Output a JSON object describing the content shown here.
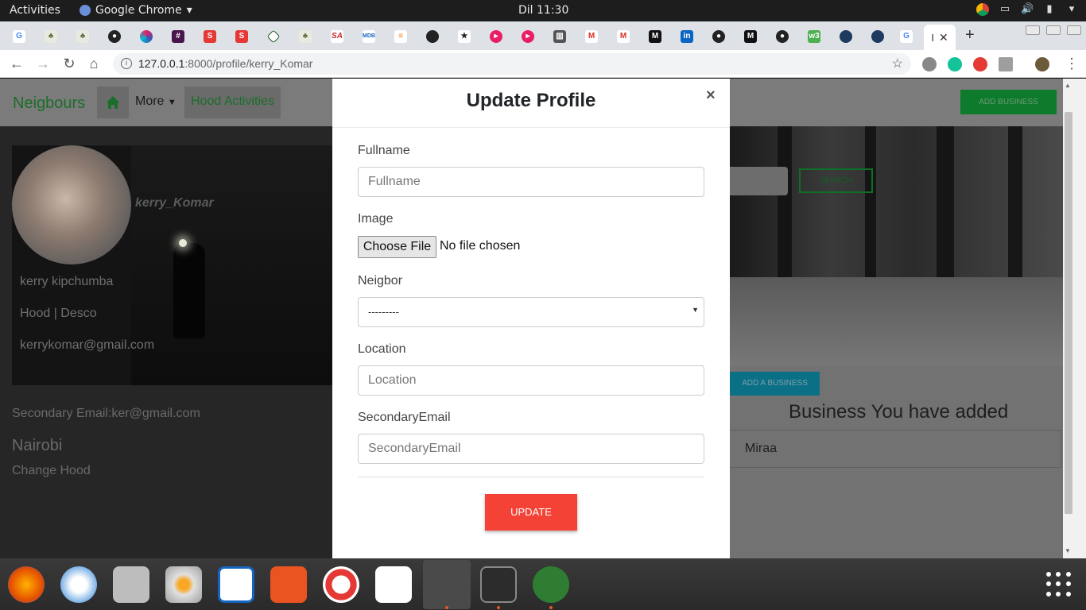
{
  "topbar": {
    "activities": "Activities",
    "app_name": "Google Chrome",
    "clock": "Dil 11:30"
  },
  "browser": {
    "url_host": "127.0.0.1",
    "url_path": ":8000/profile/kerry_Komar",
    "active_tab_label": "I",
    "new_tab": "+"
  },
  "site": {
    "brand": "Neigbours",
    "more": "More",
    "hood_activities": "Hood Activities",
    "add_business": "ADD BUSINESS"
  },
  "profile": {
    "username": "kerry_Komar",
    "fullname": "kerry kipchumba",
    "hood": "Hood | Desco",
    "email": "kerrykomar@gmail.com",
    "secondary_email": "Secondary Email:ker@gmail.com",
    "city": "Nairobi",
    "change_hood": "Change Hood"
  },
  "right_panel": {
    "search": "SEARCH",
    "add_a_business": "ADD A BUSINESS",
    "business_title": "Business You have added",
    "businesses": [
      "Miraa"
    ]
  },
  "modal": {
    "title": "Update Profile",
    "close": "×",
    "fields": {
      "fullname_label": "Fullname",
      "fullname_placeholder": "Fullname",
      "image_label": "Image",
      "choose_file": "Choose File",
      "no_file": "No file chosen",
      "neighbor_label": "Neigbor",
      "neighbor_value": "---------",
      "location_label": "Location",
      "location_placeholder": "Location",
      "secondary_email_label": "SecondaryEmail",
      "secondary_email_placeholder": "SecondaryEmail"
    },
    "submit": "UPDATE"
  }
}
